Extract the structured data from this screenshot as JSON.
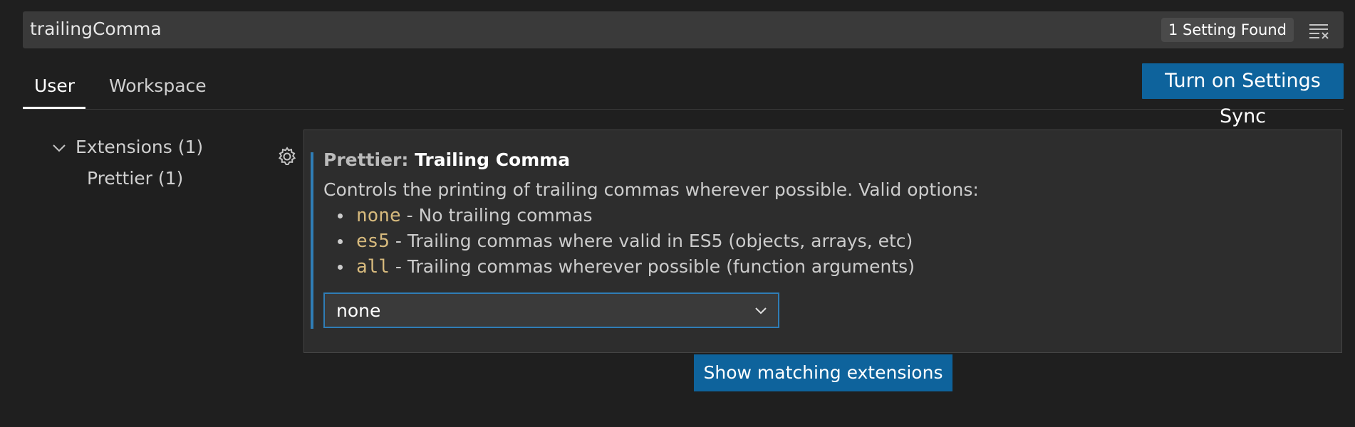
{
  "search": {
    "value": "trailingComma",
    "result_count": "1 Setting Found"
  },
  "tabs": [
    {
      "label": "User",
      "active": true
    },
    {
      "label": "Workspace",
      "active": false
    }
  ],
  "sync_button": "Turn on Settings Sync",
  "tree": {
    "group_label": "Extensions (1)",
    "child_label": "Prettier (1)"
  },
  "setting": {
    "category": "Prettier: ",
    "name": "Trailing Comma",
    "description": "Controls the printing of trailing commas wherever possible. Valid options:",
    "options": [
      {
        "code": "none",
        "text": " - No trailing commas"
      },
      {
        "code": "es5",
        "text": " - Trailing commas where valid in ES5 (objects, arrays, etc)"
      },
      {
        "code": "all",
        "text": " - Trailing commas wherever possible (function arguments)"
      }
    ],
    "selected_value": "none"
  },
  "show_extensions_button": "Show matching extensions",
  "colors": {
    "accent": "#0e639c",
    "focus_border": "#2f7db6",
    "code_color": "#d7ba7d"
  },
  "icons": [
    "clear-filter-icon",
    "chevron-down-icon",
    "gear-icon"
  ]
}
